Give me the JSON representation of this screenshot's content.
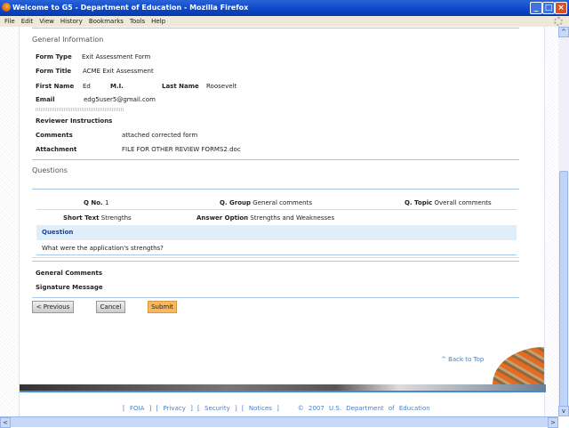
{
  "window": {
    "title": "Welcome to G5 - Department of Education - Mozilla Firefox"
  },
  "menu": [
    "File",
    "Edit",
    "View",
    "History",
    "Bookmarks",
    "Tools",
    "Help"
  ],
  "general": {
    "heading": "General Information",
    "form_type_label": "Form Type",
    "form_type": "Exit Assessment Form",
    "form_title_label": "Form Title",
    "form_title": "ACME Exit Assessment",
    "first_name_label": "First Name",
    "first_name": "Ed",
    "mi_label": "M.I.",
    "last_name_label": "Last Name",
    "last_name": "Roosevelt",
    "email_label": "Email",
    "email": "edg5user5@gmail.com",
    "reviewer_label": "Reviewer Instructions",
    "comments_label": "Comments",
    "comments": "attached corrected form",
    "attachment_label": "Attachment",
    "attachment": "FILE FOR OTHER REVIEW FORMS2.doc"
  },
  "questions": {
    "heading": "Questions",
    "qno_label": "Q No.",
    "qno": "1",
    "qgroup_label": "Q. Group",
    "qgroup": "General comments",
    "qtopic_label": "Q. Topic",
    "qtopic": "Overall comments",
    "short_label": "Short Text",
    "short": "Strengths",
    "answer_label": "Answer Option",
    "answer": "Strengths and Weaknesses",
    "question_header": "Question",
    "question_text": "What were the application's strengths?"
  },
  "general_comments_label": "General Comments",
  "signature_label": "Signature Message",
  "buttons": {
    "previous": "< Previous",
    "cancel": "Cancel",
    "submit": "Submit"
  },
  "back_to_top": "^ Back to Top",
  "footer": {
    "links": [
      "FOIA",
      "Privacy",
      "Security",
      "Notices"
    ],
    "copyright": "© 2007 U.S. Department of Education"
  },
  "colors": {
    "submit": "#f8b860",
    "accent": "#4a7fc8",
    "band": "#dfeef8"
  }
}
